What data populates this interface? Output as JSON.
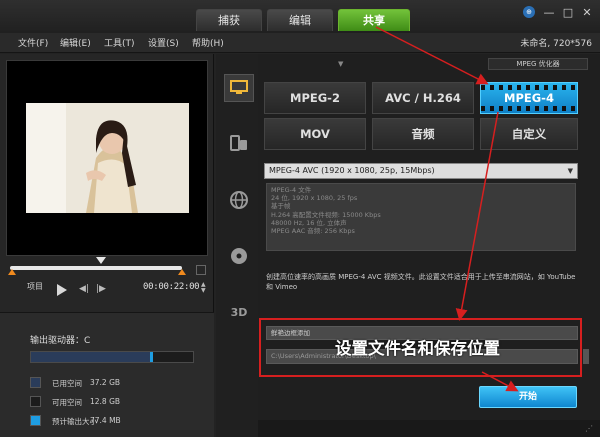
{
  "tabs": [
    "捕获",
    "编辑",
    "共享"
  ],
  "menu": [
    "文件(F)",
    "编辑(E)",
    "工具(T)",
    "设置(S)",
    "帮助(H)"
  ],
  "project_info": "未命名, 720*576",
  "window_buttons": [
    "—",
    "□",
    "✕"
  ],
  "player": {
    "label": "项目",
    "timecode": "00:00:22:00"
  },
  "drive": {
    "title": "输出驱动器：C",
    "used_fill_fraction": 0.75,
    "legend": [
      {
        "label": "已用空间",
        "value": "37.2 GB",
        "color": "#2a3c5a"
      },
      {
        "label": "可用空间",
        "value": "12.8 GB",
        "color": "#1c1c1c"
      },
      {
        "label": "预计输出大小",
        "value": "77.4 MB",
        "color": "#1e9de2"
      }
    ]
  },
  "sidebar_icons": [
    "monitor-icon",
    "mobile-device-icon",
    "globe-icon",
    "disc-icon",
    "3d-icon"
  ],
  "optimizer_label": "MPEG 优化器",
  "formats": {
    "row1": [
      "MPEG-2",
      "AVC / H.264",
      "MPEG-4"
    ],
    "row2": [
      "MOV",
      "音频",
      "自定义"
    ],
    "active": "MPEG-4"
  },
  "profile": "MPEG-4 AVC (1920 x 1080, 25p, 15Mbps)",
  "details": [
    "MPEG-4 文件",
    "24 位, 1920 x 1080, 25 fps",
    "基于帧",
    "H.264 高配置文件视频: 15000 Kbps",
    "48000 Hz, 16 位, 立体声",
    "MPEG AAC 音频: 256 Kbps"
  ],
  "description": "创建高位速率的高画质 MPEG-4 AVC 视频文件。此设置文件适合用于上传至串流网站，如 YouTube 和 Vimeo",
  "file_name": "鲜艳边框添加",
  "file_path": "C:\\Users\\Administrator\\Desktop\\",
  "annotation": "设置文件名和保存位置",
  "start_button": "开始",
  "colors": {
    "accent_green": "#4aa51f",
    "accent_blue": "#1e9de2",
    "annotation_red": "#d61f1f"
  }
}
